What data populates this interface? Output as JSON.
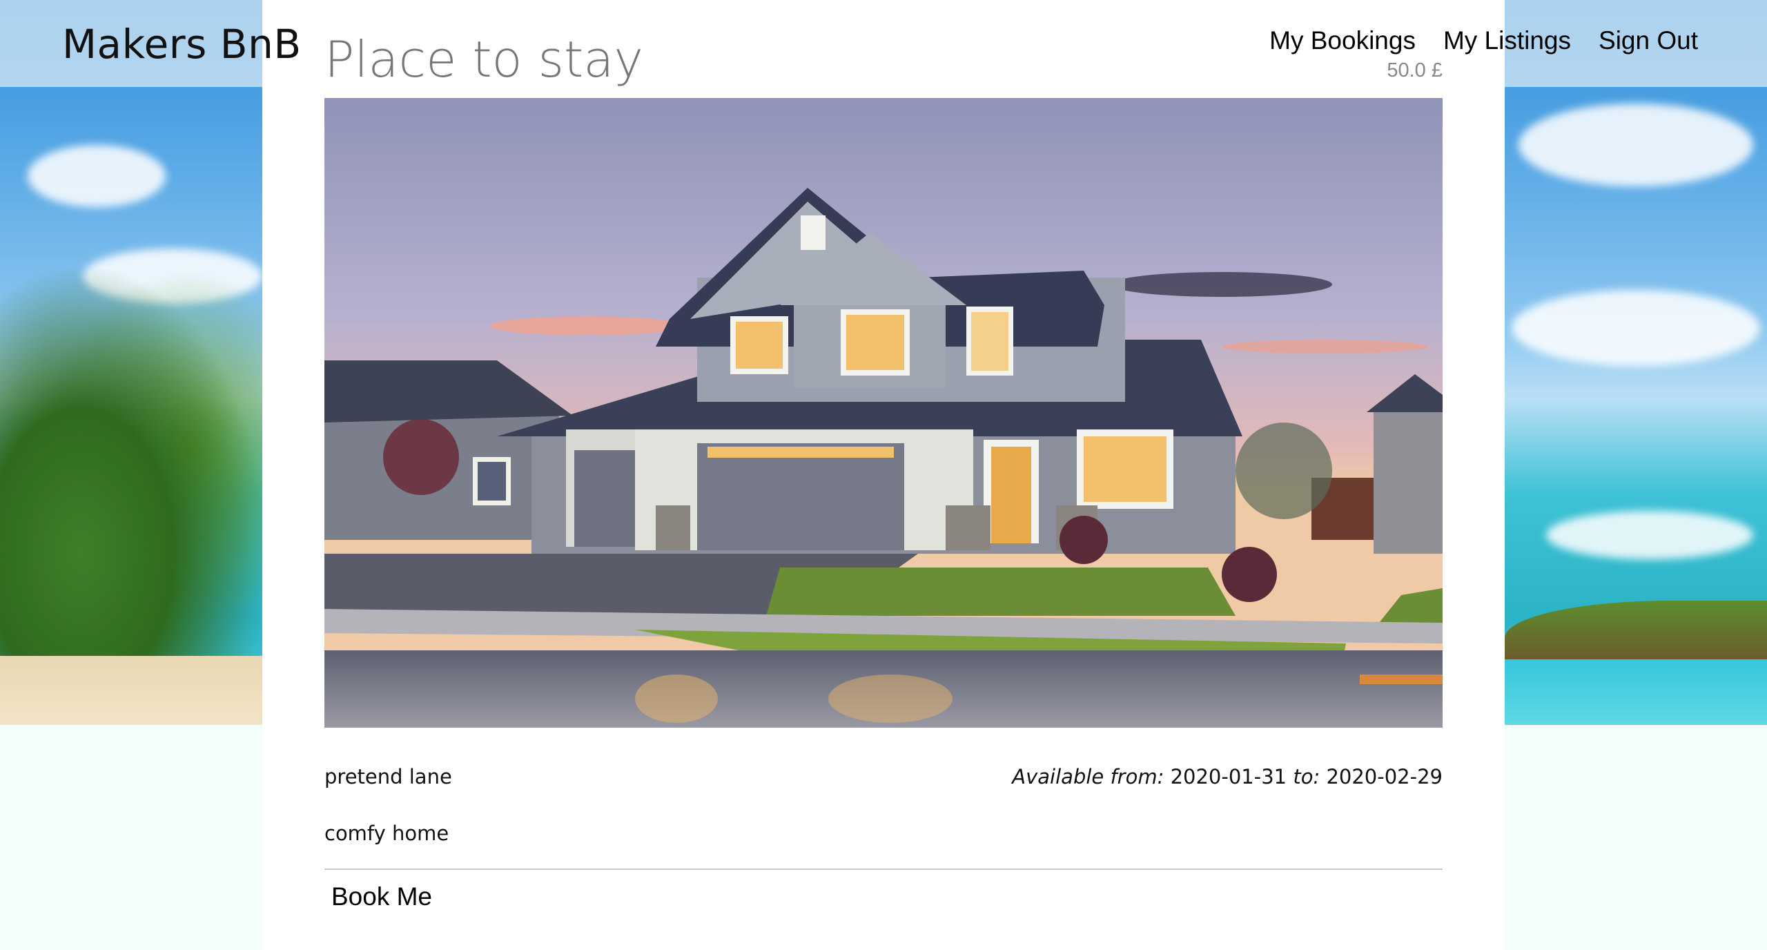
{
  "header": {
    "logo": "Makers BnB",
    "nav": [
      {
        "label": "My Bookings"
      },
      {
        "label": "My Listings"
      },
      {
        "label": "Sign Out"
      }
    ]
  },
  "listing": {
    "title": "Place to stay",
    "price": "50.0 £",
    "photo_icon": "house-photo",
    "address": "pretend lane",
    "available_from_label": "Available from:",
    "available_from": "2020-01-31",
    "available_to_label": "to:",
    "available_to": "2020-02-29",
    "description": "comfy home",
    "book_label": "Book Me"
  },
  "colors": {
    "page_background": "#f3fffa",
    "card": "#ffffff",
    "title": "#777777",
    "divider": "#c8c8c8"
  }
}
